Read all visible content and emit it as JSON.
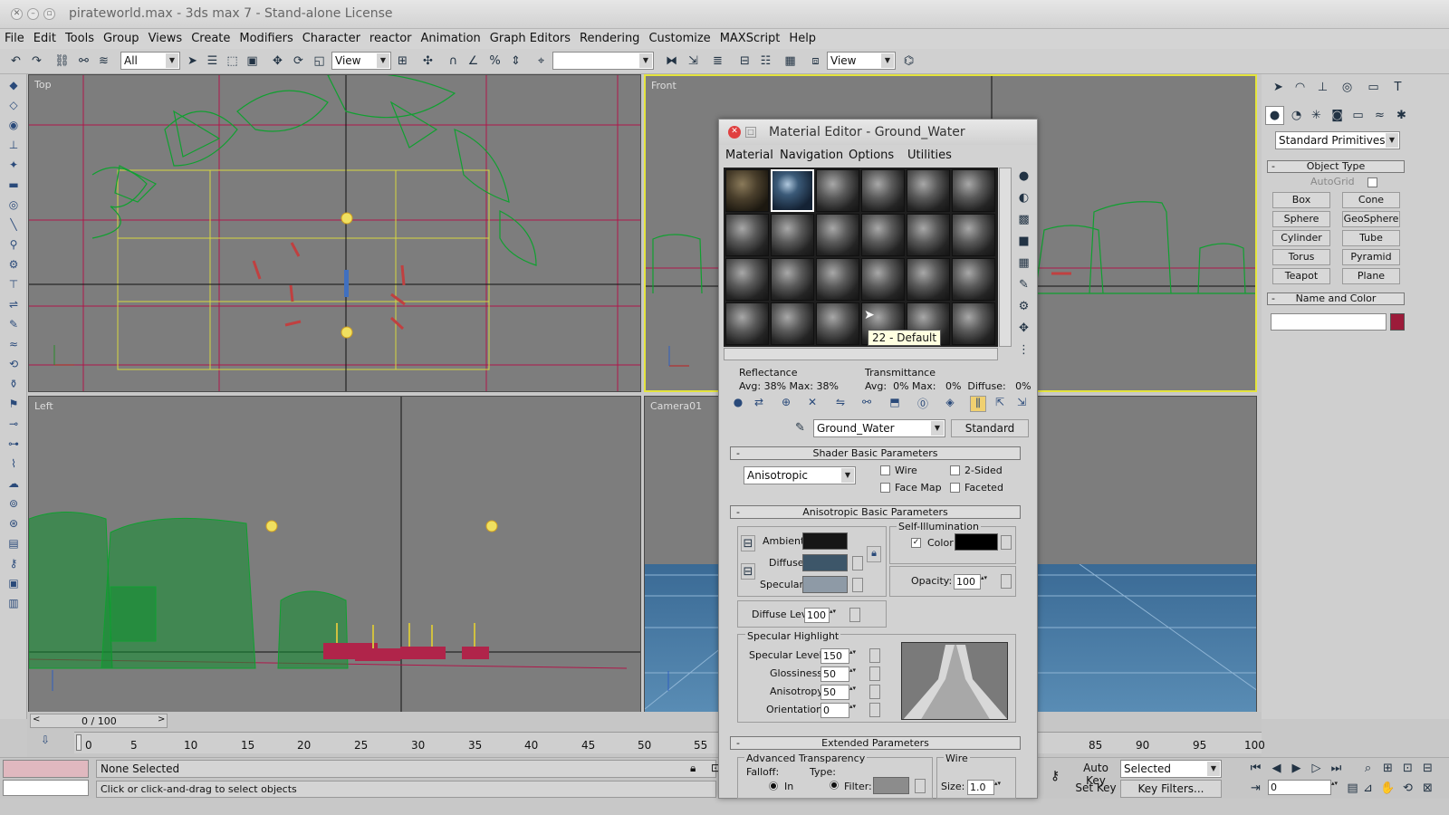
{
  "window": {
    "title": "pirateworld.max - 3ds max 7  - Stand-alone License"
  },
  "menu": [
    "File",
    "Edit",
    "Tools",
    "Group",
    "Views",
    "Create",
    "Modifiers",
    "Character",
    "reactor",
    "Animation",
    "Graph Editors",
    "Rendering",
    "Customize",
    "MAXScript",
    "Help"
  ],
  "toolbar": {
    "filter": "All",
    "refcoord": "View",
    "named_sel": "",
    "view2": "View"
  },
  "viewports": {
    "top": "Top",
    "front": "Front",
    "left": "Left",
    "camera": "Camera01"
  },
  "command_panel": {
    "category": "Standard Primitives",
    "object_type": "Object Type",
    "autogrid": "AutoGrid",
    "primitives": [
      "Box",
      "Cone",
      "Sphere",
      "GeoSphere",
      "Cylinder",
      "Tube",
      "Torus",
      "Pyramid",
      "Teapot",
      "Plane"
    ],
    "name_color": "Name and Color",
    "color": "#9c1b3a"
  },
  "material_editor": {
    "title": "Material Editor - Ground_Water",
    "menu": [
      "Material",
      "Navigation",
      "Options",
      "Utilities"
    ],
    "tooltip": "22 - Default",
    "reflectance": {
      "label": "Reflectance",
      "avg_max": "Avg: 38% Max: 38%"
    },
    "transmittance": {
      "label": "Transmittance",
      "avg_max": "Avg:  0% Max:   0%  Diffuse:   0%"
    },
    "material_name": "Ground_Water",
    "material_type": "Standard",
    "shader_rollout": "Shader Basic Parameters",
    "shader": "Anisotropic",
    "shader_checks": {
      "wire": "Wire",
      "two_sided": "2-Sided",
      "face_map": "Face Map",
      "faceted": "Faceted"
    },
    "aniso_rollout": "Anisotropic Basic Parameters",
    "self_illum": {
      "label": "Self-Illumination",
      "color_label": "Color",
      "checked_mark": "✓"
    },
    "ambient": "Ambient:",
    "diffuse": "Diffuse:",
    "specular": "Specular:",
    "colors": {
      "ambient": "#161616",
      "diffuse": "#3d5669",
      "specular": "#8e9aa6",
      "self_illum": "#000000"
    },
    "opacity": {
      "label": "Opacity:",
      "value": "100"
    },
    "diffuse_level": {
      "label": "Diffuse Lev:",
      "value": "100"
    },
    "spec_highlight": {
      "label": "Specular Highlight",
      "level_label": "Specular Level:",
      "level": "150",
      "gloss_label": "Glossiness:",
      "gloss": "50",
      "aniso_label": "Anisotropy:",
      "aniso": "50",
      "orient_label": "Orientation:",
      "orient": "0"
    },
    "extended_rollout": "Extended Parameters",
    "adv_transparency": {
      "label": "Advanced Transparency",
      "falloff": "Falloff:",
      "in": "In",
      "type": "Type:",
      "filter": "Filter:"
    },
    "wire": {
      "label": "Wire",
      "size_label": "Size:",
      "size": "1.0"
    }
  },
  "timeline": {
    "frame": "0 / 100",
    "ticks": [
      "0",
      "5",
      "10",
      "15",
      "20",
      "25",
      "30",
      "35",
      "40",
      "45",
      "50",
      "55",
      "85",
      "90",
      "95",
      "100"
    ]
  },
  "status": {
    "selection": "None Selected",
    "prompt": "Click or click-and-drag to select objects",
    "auto_key": "Auto Key",
    "set_key": "Set Key",
    "key_mode": "Selected",
    "key_filters": "Key Filters...",
    "current_frame": "0"
  }
}
